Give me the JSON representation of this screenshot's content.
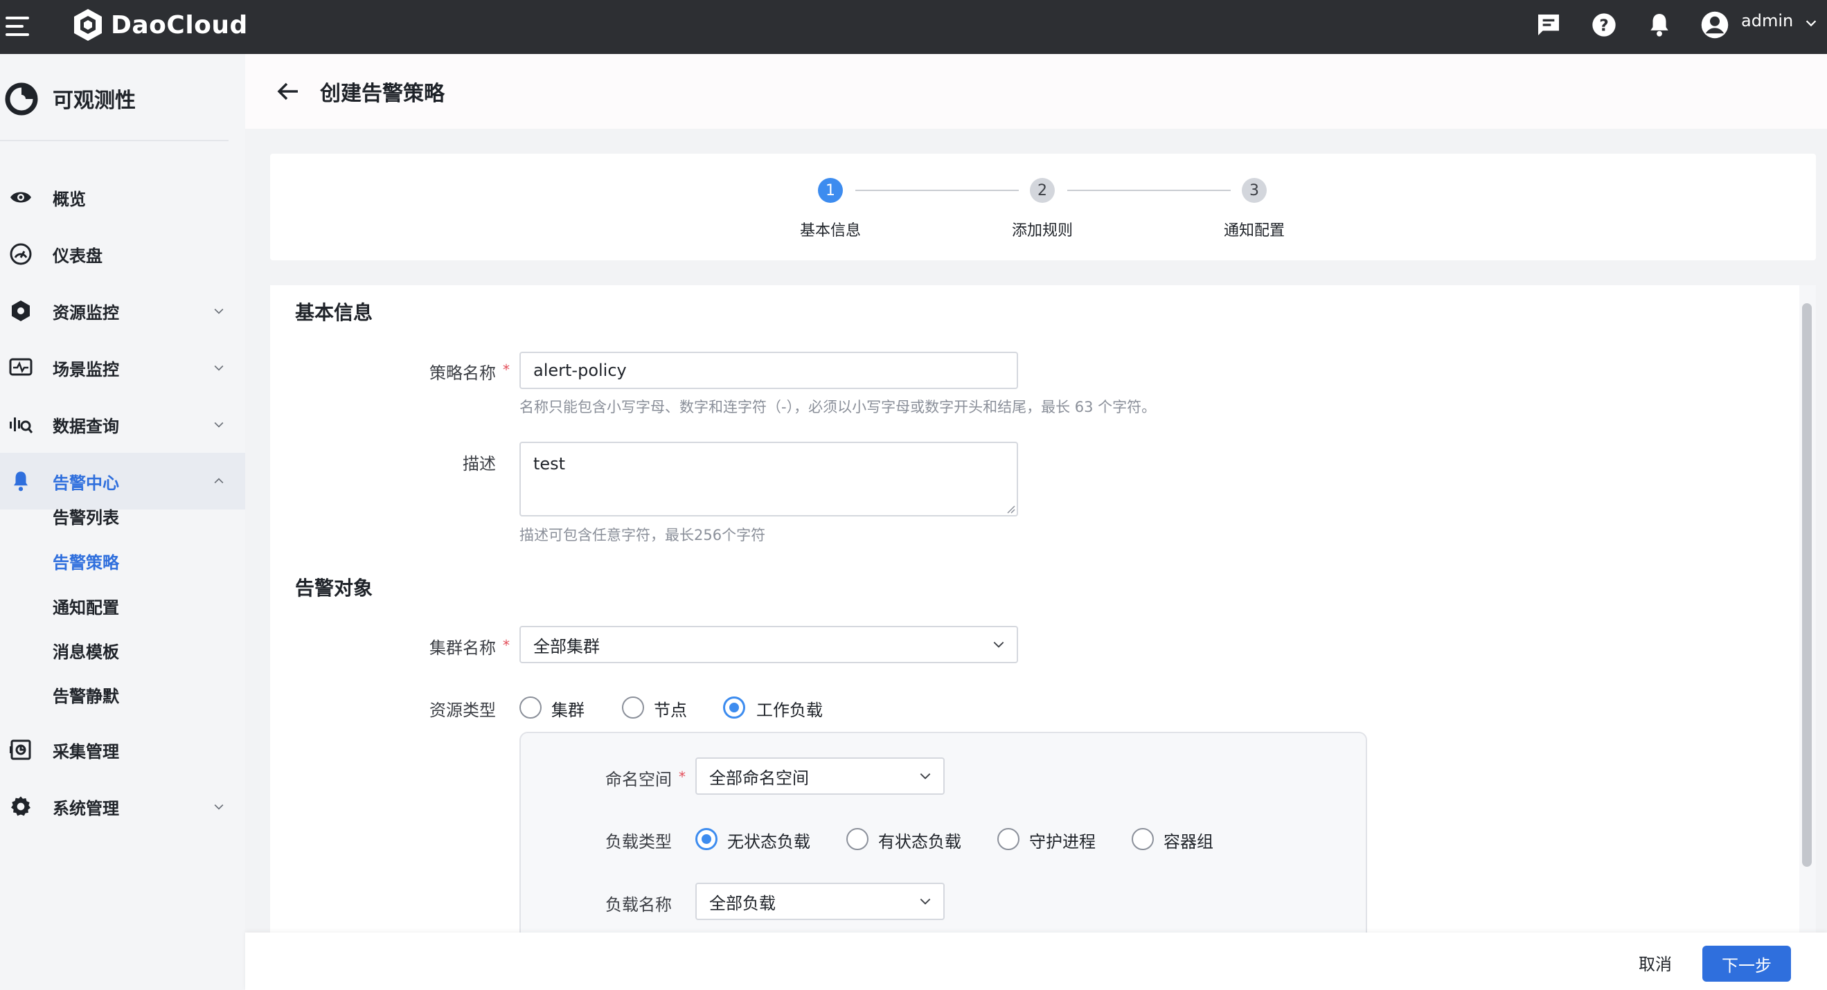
{
  "topbar": {
    "brand": "DaoCloud",
    "user": "admin",
    "icons": [
      "message-icon",
      "help-icon",
      "bell-icon",
      "user-avatar-icon"
    ]
  },
  "sidebar": {
    "product": "可观测性",
    "items": [
      {
        "label": "概览",
        "icon": "eye-icon"
      },
      {
        "label": "仪表盘",
        "icon": "gauge-icon"
      },
      {
        "label": "资源监控",
        "icon": "hexagon-icon"
      },
      {
        "label": "场景监控",
        "icon": "pulse-icon"
      },
      {
        "label": "数据查询",
        "icon": "search-chart-icon"
      },
      {
        "label": "告警中心",
        "icon": "bell-icon"
      },
      {
        "label": "采集管理",
        "icon": "collect-icon"
      },
      {
        "label": "系统管理",
        "icon": "gear-icon"
      }
    ],
    "sub_items": [
      "告警列表",
      "告警策略",
      "通知配置",
      "消息模板",
      "告警静默"
    ]
  },
  "page": {
    "title": "创建告警策略"
  },
  "steps": [
    {
      "num": "1",
      "label": "基本信息",
      "state": "current"
    },
    {
      "num": "2",
      "label": "添加规则",
      "state": "pending"
    },
    {
      "num": "3",
      "label": "通知配置",
      "state": "pending"
    }
  ],
  "basic": {
    "section_title": "基本信息",
    "name_label": "策略名称",
    "name_value": "alert-policy",
    "name_hint": "名称只能包含小写字母、数字和连字符（-），必须以小写字母或数字开头和结尾，最长 63 个字符。",
    "desc_label": "描述",
    "desc_value": "test",
    "desc_hint": "描述可包含任意字符，最长256个字符"
  },
  "target": {
    "section_title": "告警对象",
    "cluster_label": "集群名称",
    "cluster_value": "全部集群",
    "resource_type_label": "资源类型",
    "resource_types": [
      "集群",
      "节点",
      "工作负载"
    ],
    "resource_type_selected": "工作负载",
    "namespace_label": "命名空间",
    "namespace_value": "全部命名空间",
    "workload_type_label": "负载类型",
    "workload_types": [
      "无状态负载",
      "有状态负载",
      "守护进程",
      "容器组"
    ],
    "workload_type_selected": "无状态负载",
    "workload_name_label": "负载名称",
    "workload_name_value": "全部负载"
  },
  "footer": {
    "cancel": "取消",
    "next": "下一步"
  },
  "colors": {
    "accent": "#2f6fdd",
    "step_active": "#3d8cef",
    "topbar": "#2d2f33",
    "required": "#e34d59"
  }
}
